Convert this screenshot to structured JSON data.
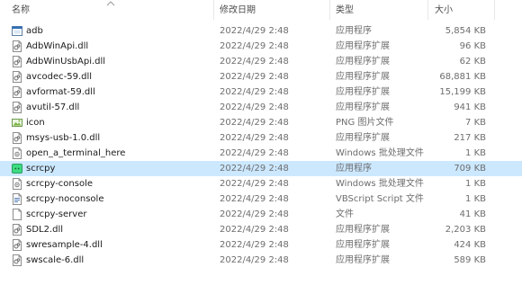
{
  "header": {
    "name": "名称",
    "date": "修改日期",
    "type": "类型",
    "size": "大小"
  },
  "files": [
    {
      "name": "adb",
      "date": "2022/4/29 2:48",
      "type": "应用程序",
      "size": "5,854 KB",
      "icon": "exe-icon"
    },
    {
      "name": "AdbWinApi.dll",
      "date": "2022/4/29 2:48",
      "type": "应用程序扩展",
      "size": "96 KB",
      "icon": "dll-icon"
    },
    {
      "name": "AdbWinUsbApi.dll",
      "date": "2022/4/29 2:48",
      "type": "应用程序扩展",
      "size": "62 KB",
      "icon": "dll-icon"
    },
    {
      "name": "avcodec-59.dll",
      "date": "2022/4/29 2:48",
      "type": "应用程序扩展",
      "size": "68,881 KB",
      "icon": "dll-icon"
    },
    {
      "name": "avformat-59.dll",
      "date": "2022/4/29 2:48",
      "type": "应用程序扩展",
      "size": "15,199 KB",
      "icon": "dll-icon"
    },
    {
      "name": "avutil-57.dll",
      "date": "2022/4/29 2:48",
      "type": "应用程序扩展",
      "size": "941 KB",
      "icon": "dll-icon"
    },
    {
      "name": "icon",
      "date": "2022/4/29 2:48",
      "type": "PNG 图片文件",
      "size": "7 KB",
      "icon": "png-icon"
    },
    {
      "name": "msys-usb-1.0.dll",
      "date": "2022/4/29 2:48",
      "type": "应用程序扩展",
      "size": "217 KB",
      "icon": "dll-icon"
    },
    {
      "name": "open_a_terminal_here",
      "date": "2022/4/29 2:48",
      "type": "Windows 批处理文件",
      "size": "1 KB",
      "icon": "bat-icon"
    },
    {
      "name": "scrcpy",
      "date": "2022/4/29 2:48",
      "type": "应用程序",
      "size": "709 KB",
      "icon": "scrcpy-app-icon",
      "selected": true
    },
    {
      "name": "scrcpy-console",
      "date": "2022/4/29 2:48",
      "type": "Windows 批处理文件",
      "size": "1 KB",
      "icon": "bat-icon"
    },
    {
      "name": "scrcpy-noconsole",
      "date": "2022/4/29 2:48",
      "type": "VBScript Script 文件",
      "size": "1 KB",
      "icon": "vbs-icon"
    },
    {
      "name": "scrcpy-server",
      "date": "2022/4/29 2:48",
      "type": "文件",
      "size": "41 KB",
      "icon": "blank-file-icon"
    },
    {
      "name": "SDL2.dll",
      "date": "2022/4/29 2:48",
      "type": "应用程序扩展",
      "size": "2,203 KB",
      "icon": "dll-icon"
    },
    {
      "name": "swresample-4.dll",
      "date": "2022/4/29 2:48",
      "type": "应用程序扩展",
      "size": "424 KB",
      "icon": "dll-icon"
    },
    {
      "name": "swscale-6.dll",
      "date": "2022/4/29 2:48",
      "type": "应用程序扩展",
      "size": "589 KB",
      "icon": "dll-icon"
    }
  ],
  "colors": {
    "selected_row": "#cce8ff",
    "header_text": "#4d4d4d",
    "secondary_text": "#6d6d6d"
  }
}
